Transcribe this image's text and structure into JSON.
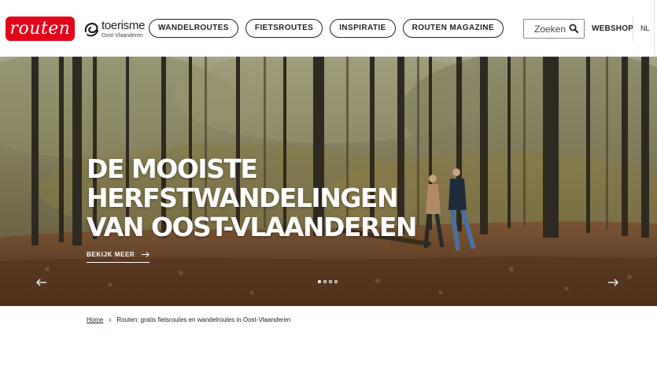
{
  "brand": {
    "logo_text": "routen",
    "partner_line1": "toerisme",
    "partner_line2": "Oost-Vlaanderen",
    "accent": "#e3061b"
  },
  "nav": [
    {
      "label": "WANDELROUTES"
    },
    {
      "label": "FIETSROUTES"
    },
    {
      "label": "INSPIRATIE"
    },
    {
      "label": "ROUTEN MAGAZINE"
    }
  ],
  "search": {
    "placeholder": "Zoeken",
    "icon": "search-icon"
  },
  "webshop_label": "WEBSHOP",
  "language": "NL",
  "hero": {
    "headline_line1": "DE MOOISTE",
    "headline_line2": "HERFSTWANDELINGEN",
    "headline_line3": "VAN OOST-VLAANDEREN",
    "cta_label": "BEKIJK MEER",
    "slides_total": 4,
    "slide_active": 1
  },
  "breadcrumb": {
    "home": "Home",
    "current": "Routen: gratis fietsroutes en wandelroutes in Oost-Vlaanderen"
  }
}
